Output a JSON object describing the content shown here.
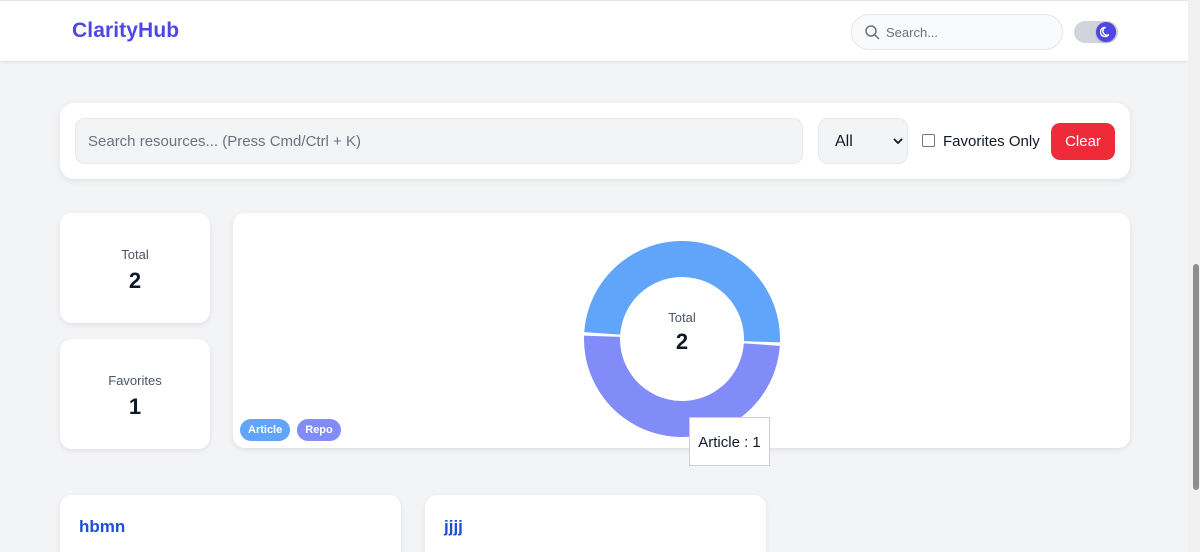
{
  "header": {
    "logo": "ClarityHub",
    "search_placeholder": "Search...",
    "theme_icon": "moon-icon"
  },
  "filters": {
    "search_placeholder": "Search resources... (Press Cmd/Ctrl + K)",
    "type_select_value": "All",
    "favorites_label": "Favorites Only",
    "favorites_checked": false,
    "clear_label": "Clear"
  },
  "stats": {
    "total_label": "Total",
    "total_value": "2",
    "favorites_label": "Favorites",
    "favorites_value": "1"
  },
  "chart_data": {
    "type": "pie",
    "center_label": "Total",
    "center_value": "2",
    "categories": [
      "Article",
      "Repo"
    ],
    "values": [
      1,
      1
    ],
    "colors": [
      "#60a5fa",
      "#818cf8"
    ],
    "tooltip": "Article : 1"
  },
  "resources": [
    {
      "title": "hbmn"
    },
    {
      "title": "jjjj"
    }
  ],
  "colors": {
    "brand": "#4f46e5",
    "danger": "#ef2b3a",
    "link": "#1d4ed8"
  }
}
